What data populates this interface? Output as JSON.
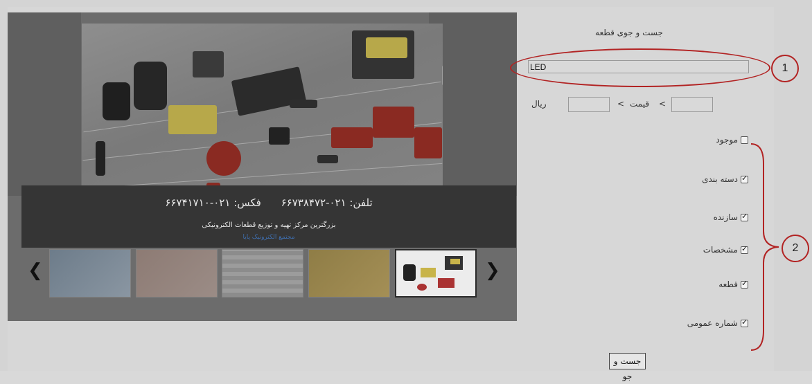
{
  "slider": {
    "caption_phone": "تلفن: ۰۲۱-۶۶۷۳۸۴۷۲",
    "caption_fax": "فکس: ۰۲۱-۶۶۷۴۱۷۱۰",
    "caption_subtitle": "بزرگترین مرکز تهیه و توزیع قطعات الکترونیکی",
    "caption_link": "مجتمع الکترونیک پایا",
    "prev_arrow": "❮",
    "next_arrow": "❯"
  },
  "search": {
    "title": "جست و جوی قطعه",
    "query_value": "LED",
    "price_label": "قیمت",
    "price_unit": "ریال",
    "lt_symbol": ">",
    "submit_label": "جست و جو"
  },
  "filters": [
    {
      "label": "موجود",
      "checked": false
    },
    {
      "label": "دسته بندی",
      "checked": true
    },
    {
      "label": "سازنده",
      "checked": true
    },
    {
      "label": "مشخصات",
      "checked": true
    },
    {
      "label": "قطعه",
      "checked": true
    },
    {
      "label": "شماره عمومی",
      "checked": true
    }
  ],
  "annotations": {
    "marker_1": "1",
    "marker_2": "2",
    "color": "#b22323"
  }
}
